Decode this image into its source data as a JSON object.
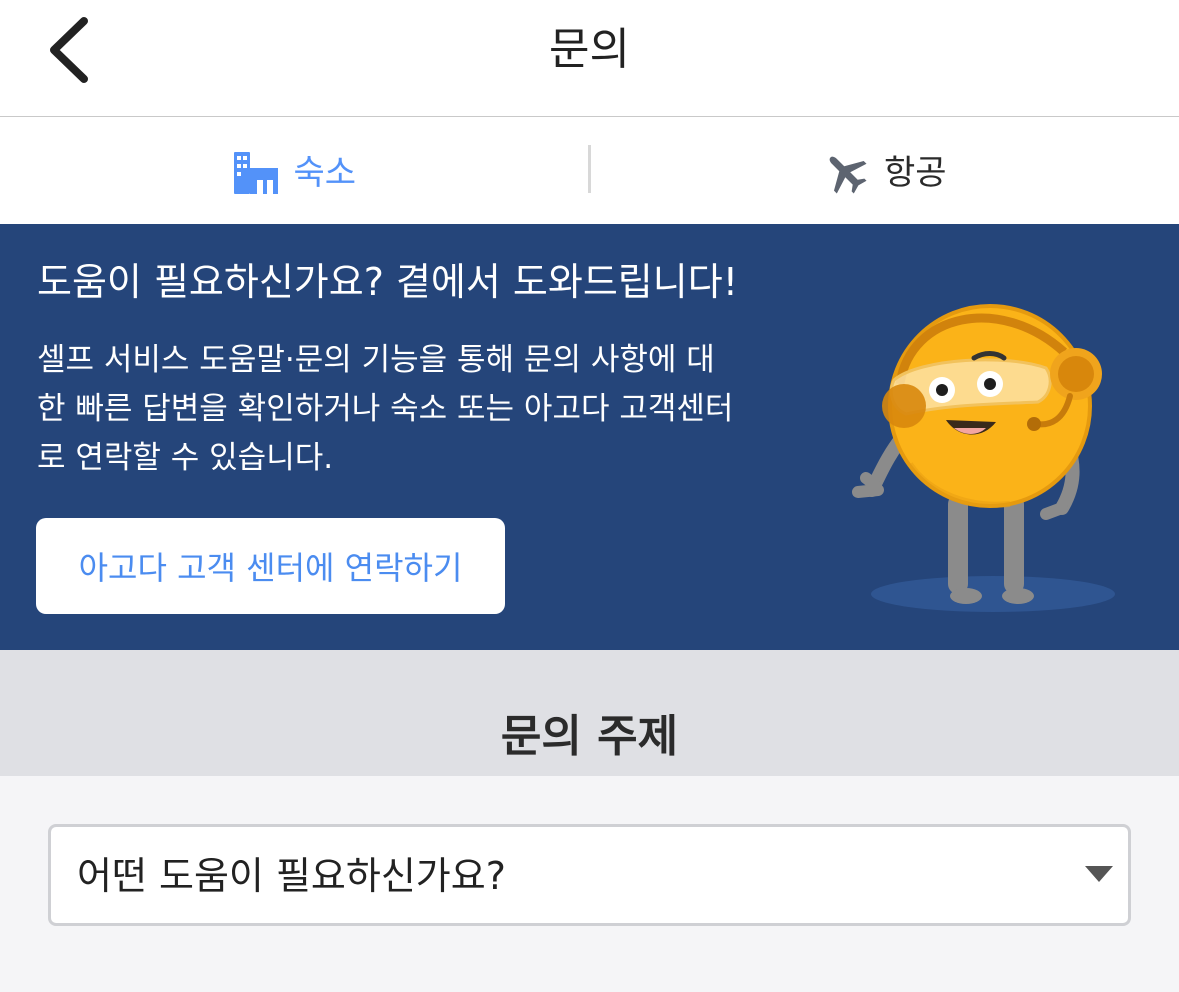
{
  "header": {
    "title": "문의",
    "back_icon": "chevron-left-icon"
  },
  "tabs": [
    {
      "label": "숙소",
      "icon": "hotel-building-icon",
      "active": true
    },
    {
      "label": "항공",
      "icon": "airplane-icon",
      "active": false
    }
  ],
  "banner": {
    "title": "도움이 필요하신가요? 곁에서 도와드립니다!",
    "body_lines": [
      "셀프 서비스 도움말·문의 기능을 통해 문의 사항에 대",
      "한 빠른 답변을 확인하거나 숙소 또는 아고다 고객센터",
      "로 연락할 수 있습니다."
    ],
    "button_label": "아고다 고객 센터에 연락하기",
    "illustration": "customer-support-mascot",
    "background_color": "#25457a"
  },
  "topic": {
    "title": "문의 주제",
    "select_value": "어떤 도움이 필요하신가요?",
    "arrow_icon": "triangle-down-icon"
  },
  "colors": {
    "accent": "#5392f9",
    "banner": "#25457a",
    "section_gray": "#dfe0e4"
  }
}
